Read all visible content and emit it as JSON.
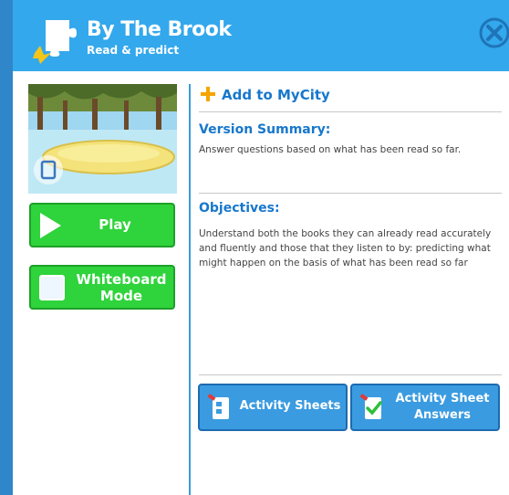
{
  "header": {
    "title": "By The Brook",
    "subtitle": "Read & predict"
  },
  "left": {
    "play_label": "Play",
    "whiteboard_label_line1": "Whiteboard",
    "whiteboard_label_line2": "Mode"
  },
  "right": {
    "add_label": "Add to MyCity",
    "version_title": "Version Summary:",
    "version_text": "Answer questions based on what has been read so far.",
    "objectives_title": "Objectives:",
    "objectives_text": "Understand both the books they can already read accurately and fluently and those that they listen to by: predicting what might happen on the basis of what has been read so far"
  },
  "buttons": {
    "activity_sheets": "Activity Sheets",
    "answers_line1": "Activity Sheet",
    "answers_line2": "Answers"
  },
  "colors": {
    "header": "#33a8ec",
    "accent_blue": "#1777cc",
    "play_green": "#2fd33b",
    "button_blue": "#3a9be0"
  }
}
